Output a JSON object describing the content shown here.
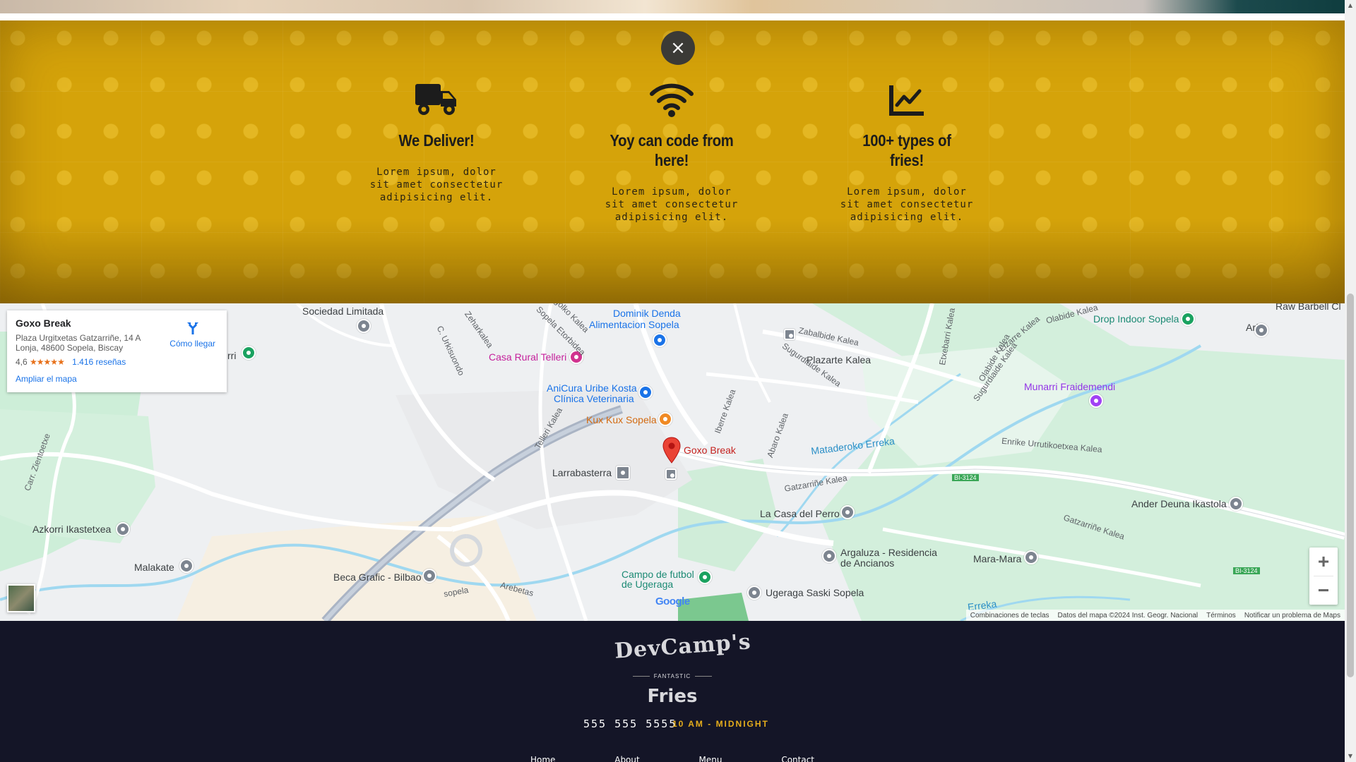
{
  "close_button": {
    "symbol": "×"
  },
  "features": [
    {
      "icon": "truck-icon",
      "title": "We Deliver!",
      "text": "Lorem ipsum, dolor sit amet consectetur adipisicing elit."
    },
    {
      "icon": "wifi-icon",
      "title": "Yoy can code from here!",
      "text": "Lorem ipsum, dolor sit amet consectetur adipisicing elit."
    },
    {
      "icon": "chart-line-icon",
      "title": "100+ types of fries!",
      "text": "Lorem ipsum, dolor sit amet consectetur adipisicing elit."
    }
  ],
  "map": {
    "card": {
      "name": "Goxo Break",
      "address": "Plaza Urgitxetas Gatzarriñe, 14 A Lonja, 48600 Sopela, Biscay",
      "rating": "4,6",
      "stars": "★★★★★",
      "reviews": "1.416 reseñas",
      "enlarge": "Ampliar el mapa",
      "directions": "Cómo llegar"
    },
    "labels": {
      "sociedad": "Sociedad Limitada",
      "dominik": "Dominik Denda",
      "alimentacion": "Alimentacion Sopela",
      "casa_rural": "Casa Rural Telleri",
      "anicura1": "AniCura Uribe Kosta",
      "anicura2": "Clínica Veterinaria",
      "kuxkux": "Kux Kux Sopela",
      "goxo": "Goxo Break",
      "larrabasterra": "Larrabasterra",
      "plazarte": "Plazarte Kalea",
      "drop_indoor": "Drop Indoor Sopela",
      "arflu": "Arflu",
      "raw_barbell": "Raw Barbell Cl",
      "munarri1": "Munarri Fraidemendi",
      "mataderoko": "Mataderoko Erreka",
      "enrike": "Enrike Urrutikoetxea Kalea",
      "ander": "Ander Deuna Ikastola",
      "gatzarrine1": "Gatzarriñe Kalea",
      "gatzarrine2": "Gatzarriñe Kalea",
      "la_casa": "La Casa del Perro",
      "argaluza1": "Argaluza - Residencia",
      "argaluza2": "de Ancianos",
      "mara": "Mara-Mara",
      "azkorri": "Azkorri Ikastetxea",
      "malakate": "Malakate",
      "beca": "Beca Grafic - Bilbao",
      "campo1": "Campo de futbol",
      "campo2": "de Ugeraga",
      "ugeraga": "Ugeraga Saski Sopela",
      "zabalbide": "Zabalbide Kalea",
      "iberre": "Iberre Kalea",
      "olabide": "Olabide Kalea",
      "olabide2": "Olabide Kalea",
      "etxebarri": "Etxebarri Kalea",
      "lizarre": "Lizarre Kalea",
      "sugurdiaide": "Sugurdiaide Kalea",
      "sugurdiaide2": "Sugurdiaide Kalea",
      "abaro": "Abaro Kalea",
      "telleri_kalea": "Telleri Kalea",
      "urkisuondo": "C. Urkisuondo",
      "etorbidea": "Sopela Etorbidea",
      "zientoetxe": "Carr. Zientoetxe",
      "arebetas": "Arebetas",
      "sopela": "sopela",
      "zehar": "Zeharkalea",
      "golko": "golko Kalea",
      "bi3124a": "BI-3124",
      "bi3124b": "BI-3124",
      "erreka": "Erreka",
      "rri": "rri",
      "google": "Google"
    },
    "attribution": [
      "Combinaciones de teclas",
      "Datos del mapa ©2024 Inst. Geogr. Nacional",
      "Términos",
      "Notificar un problema de Maps"
    ],
    "zoom_in": "+",
    "zoom_out": "−"
  },
  "footer": {
    "logo_line1": "DevCamp's",
    "logo_line2": "FANTASTIC",
    "logo_line3": "Fries",
    "phone": "555 555 5555",
    "hours": "10 AM - MIDNIGHT",
    "links": [
      "Home",
      "About",
      "Menu",
      "Contact"
    ]
  }
}
